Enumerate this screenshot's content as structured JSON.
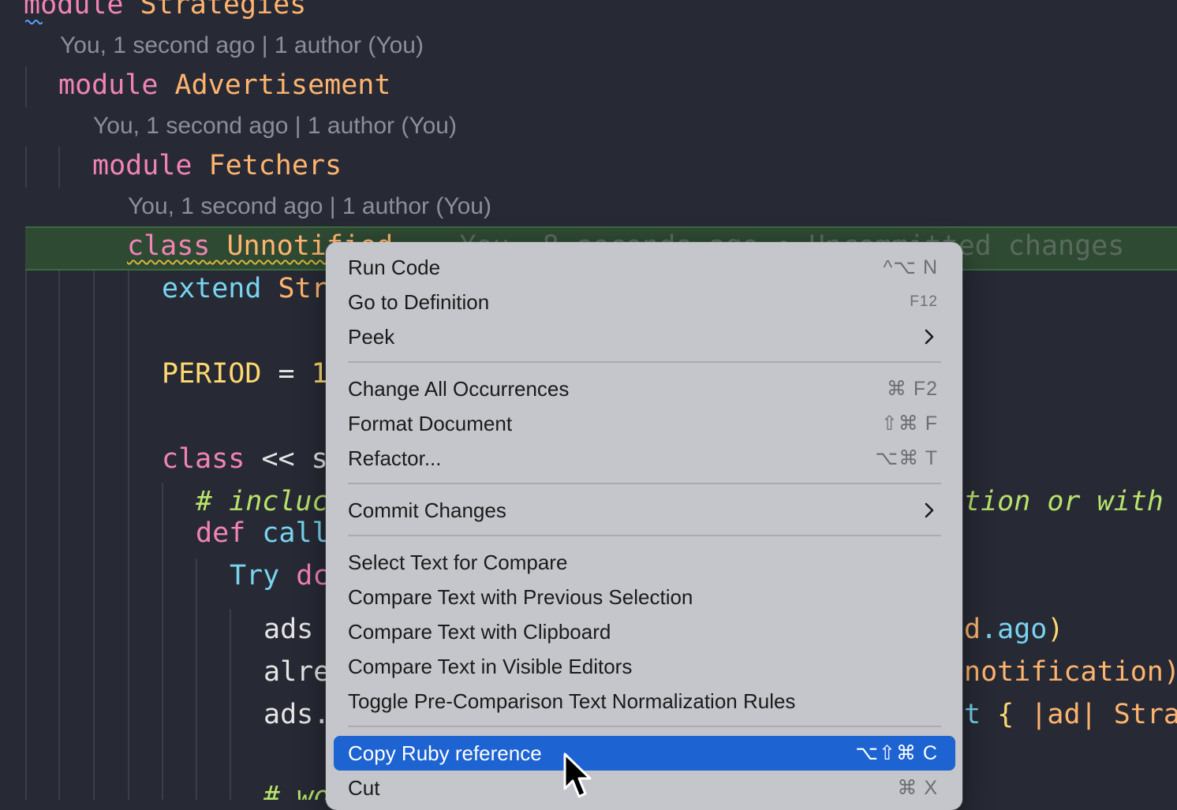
{
  "editor": {
    "blame_lens": "You, 1 second ago | 1 author (You)",
    "inline_blame": "You, 8 seconds ago • Uncommitted changes",
    "lines": {
      "l1": {
        "kw": "module",
        "name": "Strategies"
      },
      "l2": {
        "kw": "module",
        "name": "Advertisement"
      },
      "l3": {
        "kw": "module",
        "name": "Fetchers"
      },
      "l4": {
        "kw": "class",
        "name": "Unnotified"
      },
      "l5": {
        "kw": "extend",
        "rest": "Str"
      },
      "l6": {
        "const": "PERIOD",
        "op": "=",
        "rest": "1"
      },
      "l7": {
        "kw": "class",
        "op": "<<",
        "rest": "s"
      },
      "l8": {
        "comment": "# incluc",
        "comment_right": "tion or with"
      },
      "l9": {
        "kw": "def",
        "rest": "call"
      },
      "l10": {
        "left": "Try",
        "kw": "dc"
      },
      "l11": {
        "left": "ads",
        "right_a": "d",
        "right_b": ".ago",
        "right_c": ")"
      },
      "l12": {
        "left": "alre",
        "right": "notification)"
      },
      "l13": {
        "left": "ads.",
        "right_a": "t",
        "right_b": "{",
        "right_c": "|ad|",
        "right_d": "Stra"
      },
      "l14": {
        "comment": "# wo"
      }
    }
  },
  "context_menu": {
    "items": [
      {
        "label": "Run Code",
        "shortcut": "^⌥ N"
      },
      {
        "label": "Go to Definition",
        "shortcut": "F12"
      },
      {
        "label": "Peek",
        "submenu": true
      },
      {
        "label": "Change All Occurrences",
        "shortcut": "⌘ F2"
      },
      {
        "label": "Format Document",
        "shortcut": "⇧⌘ F"
      },
      {
        "label": "Refactor...",
        "shortcut": "⌥⌘ T"
      },
      {
        "label": "Commit Changes",
        "submenu": true
      },
      {
        "label": "Select Text for Compare"
      },
      {
        "label": "Compare Text with Previous Selection"
      },
      {
        "label": "Compare Text with Clipboard"
      },
      {
        "label": "Compare Text in Visible Editors"
      },
      {
        "label": "Toggle Pre-Comparison Text Normalization Rules"
      },
      {
        "label": "Copy Ruby reference",
        "shortcut": "⌥⇧⌘ C",
        "highlighted": true
      },
      {
        "label": "Cut",
        "shortcut": "⌘ X"
      }
    ]
  },
  "colors": {
    "editor_bg": "#272a35",
    "menu_bg": "#c4c6cb",
    "highlight": "#1d63d2",
    "keyword": "#f283b6",
    "name": "#ffb46e",
    "cyan": "#78d4f0",
    "comment": "#b8e26a"
  }
}
